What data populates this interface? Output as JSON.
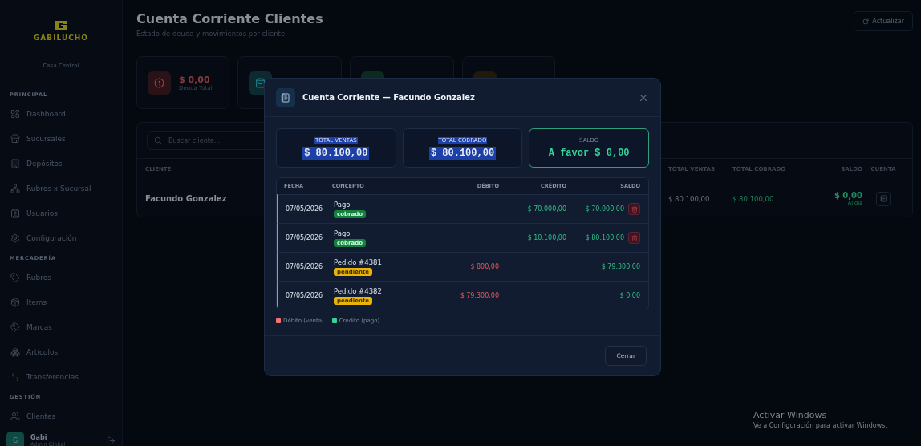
{
  "sidebar": {
    "logo": "GABILUCHO",
    "branch": "Casa Central",
    "sections": [
      {
        "title": "PRINCIPAL",
        "items": [
          "Dashboard",
          "Sucursales",
          "Depósitos",
          "Rubros x Sucursal",
          "Usuarios",
          "Configuración"
        ]
      },
      {
        "title": "MERCADERÍA",
        "items": [
          "Rubros",
          "Items",
          "Marcas",
          "Artículos",
          "Transferencias"
        ]
      },
      {
        "title": "GESTIÓN",
        "items": [
          "Clientes"
        ]
      }
    ],
    "user": {
      "initial": "G",
      "name": "Gabi",
      "role": "Admin Global"
    }
  },
  "page": {
    "title": "Cuenta Corriente Clientes",
    "subtitle": "Estado de deuda y movimientos por cliente",
    "refresh_button": "Actualizar"
  },
  "stats": [
    {
      "kind": "debt",
      "value": "$ 0,00",
      "label": "Deuda Total"
    },
    {
      "kind": "sales"
    },
    {
      "kind": "collected"
    },
    {
      "kind": "count"
    }
  ],
  "clients": {
    "search": {
      "placeholder": "Buscar cliente..."
    },
    "columns": [
      "CLIENTE",
      "TOTAL VENTAS",
      "TOTAL COBRADO",
      "SALDO",
      "CUENTA"
    ],
    "rows": [
      {
        "name": "Facundo Gonzalez",
        "total_ventas": "$ 80.100,00",
        "total_cobrado": "$ 80.100,00",
        "saldo": "$ 0,00",
        "status": "Al día"
      }
    ]
  },
  "modal": {
    "title": "Cuenta Corriente — Facundo Gonzalez",
    "summary": [
      {
        "kind": "plain",
        "label": "TOTAL VENTAS",
        "value": "$ 80.100,00",
        "text_selected": true
      },
      {
        "kind": "plain",
        "label": "TOTAL COBRADO",
        "value": "$ 80.100,00",
        "text_selected": true
      },
      {
        "kind": "balance",
        "label": "SALDO",
        "value": "A favor $ 0,00",
        "text_selected": false
      }
    ],
    "columns": [
      "FECHA",
      "CONCEPTO",
      "DÉBITO",
      "CRÉDITO",
      "SALDO"
    ],
    "rows": [
      {
        "kind": "credit",
        "fecha": "07/05/2026",
        "concepto": "Pago",
        "badge": "cobrado",
        "debito": "",
        "credito": "$ 70.000,00",
        "saldo": "$ 70.000,00"
      },
      {
        "kind": "credit",
        "fecha": "07/05/2026",
        "concepto": "Pago",
        "badge": "cobrado",
        "debito": "",
        "credito": "$ 10.100,00",
        "saldo": "$ 80.100,00"
      },
      {
        "kind": "debit",
        "fecha": "07/05/2026",
        "concepto": "Pedido #4381",
        "badge": "pendiente",
        "debito": "$ 800,00",
        "credito": "",
        "saldo": "$ 79.300,00"
      },
      {
        "kind": "debit",
        "fecha": "07/05/2026",
        "concepto": "Pedido #4382",
        "badge": "pendiente",
        "debito": "$ 79.300,00",
        "credito": "",
        "saldo": "$ 0,00"
      }
    ],
    "legend": [
      {
        "label": "Débito (venta)",
        "color": "#f87171"
      },
      {
        "label": "Crédito (pago)",
        "color": "#34d399"
      }
    ],
    "close_button": "Cerrar"
  },
  "windows_notice": {
    "title": "Activar Windows",
    "text": "Ve a Configuración para activar Windows."
  }
}
